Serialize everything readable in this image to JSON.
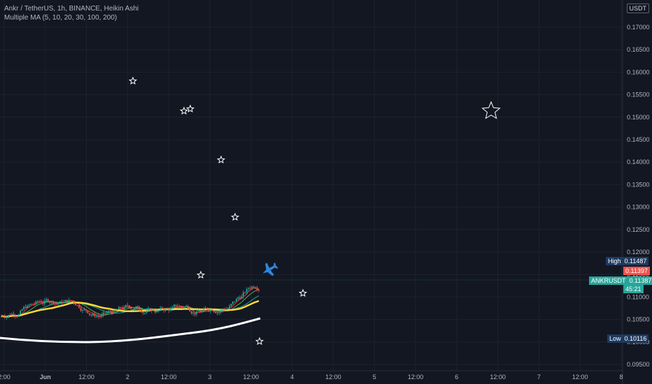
{
  "legend": {
    "symbol_line": "Ankr / TetherUS, 1h, BINANCE, Heikin Ashi",
    "indicator_line": "Multiple MA (5, 10, 20, 30, 100, 200)"
  },
  "currency_button": "USDT",
  "price_axis": {
    "min": 0.0955,
    "max": 0.1745,
    "ticks": [
      "0.17000",
      "0.16500",
      "0.16000",
      "0.15500",
      "0.15000",
      "0.14500",
      "0.14000",
      "0.13500",
      "0.13000",
      "0.12500",
      "0.12000",
      "0.11500",
      "0.11000",
      "0.10500",
      "0.10000",
      "0.09500"
    ]
  },
  "time_axis": {
    "labels": [
      "2:00",
      "Jun",
      "12:00",
      "2",
      "12:00",
      "3",
      "12:00",
      "4",
      "12:00",
      "5",
      "12:00",
      "6",
      "12:00",
      "7",
      "12:00",
      "8"
    ]
  },
  "tags": {
    "high": {
      "label": "High",
      "value": "0.11487",
      "color": "#1e3a5f"
    },
    "last_close_red": {
      "value": "0.11397",
      "color": "#ef5350"
    },
    "symbol": {
      "label": "ANKRUSDT",
      "value": "0.11387",
      "countdown": "45:21",
      "color": "#26a69a"
    },
    "low": {
      "label": "Low",
      "value": "0.10116",
      "color": "#1e3a5f"
    }
  },
  "colors": {
    "background": "#131722",
    "grid": "#1e222d",
    "up_candle": "#26a69a",
    "down_candle": "#ef5350",
    "ma_red": "#e53935",
    "ma_green": "#4caf50",
    "ma_teal": "#26a69a",
    "ma_yellow": "#fdd835",
    "ma_white": "#ffffff",
    "plane_icon": "#2e86de"
  },
  "icons": [
    "star-icon",
    "airplane-icon"
  ]
}
